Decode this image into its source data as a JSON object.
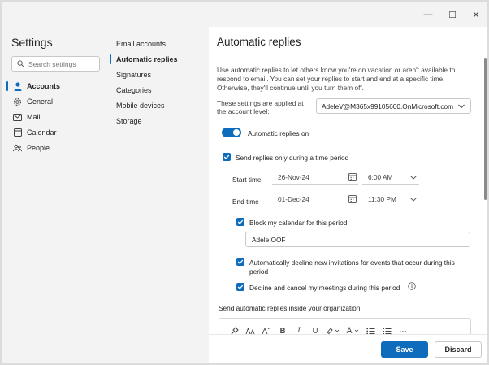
{
  "window": {
    "minimize_glyph": "—",
    "maximize_glyph": "☐",
    "close_glyph": "✕"
  },
  "settings": {
    "title": "Settings",
    "search_placeholder": "Search settings",
    "nav": [
      {
        "label": "Accounts",
        "icon": "person-icon",
        "active": true
      },
      {
        "label": "General",
        "icon": "gear-icon"
      },
      {
        "label": "Mail",
        "icon": "mail-icon"
      },
      {
        "label": "Calendar",
        "icon": "calendar-icon"
      },
      {
        "label": "People",
        "icon": "people-icon"
      }
    ]
  },
  "subnav": [
    {
      "label": "Email accounts"
    },
    {
      "label": "Automatic replies",
      "active": true
    },
    {
      "label": "Signatures"
    },
    {
      "label": "Categories"
    },
    {
      "label": "Mobile devices"
    },
    {
      "label": "Storage"
    }
  ],
  "content": {
    "heading": "Automatic replies",
    "description": "Use automatic replies to let others know you're on vacation or aren't available to respond to email. You can set your replies to start and end at a specific time. Otherwise, they'll continue until you turn them off.",
    "applied_label": "These settings are applied at the account level:",
    "account": "AdeleV@M365x99105600.OnMicrosoft.com",
    "toggle_label": "Automatic replies on",
    "toggle_on": true,
    "time_period_label": "Send replies only during a time period",
    "start_time_label": "Start time",
    "start_date": "26-Nov-24",
    "start_time": "6:00 AM",
    "end_time_label": "End time",
    "end_date": "01-Dec-24",
    "end_time": "11:30 PM",
    "block_calendar_label": "Block my calendar for this period",
    "event_title": "Adele OOF",
    "decline_invites_label_1": "Automatically decline new invitations for events that occur during this",
    "decline_invites_label_2": "period",
    "decline_cancel_label": "Decline and cancel my meetings during this period",
    "inside_org_label": "Send automatic replies inside your organization",
    "toolbar": {
      "bold": "B",
      "italic": "I",
      "underline": "U",
      "more": "···"
    }
  },
  "footer": {
    "save": "Save",
    "discard": "Discard"
  },
  "colors": {
    "accent": "#0f6cbd"
  }
}
